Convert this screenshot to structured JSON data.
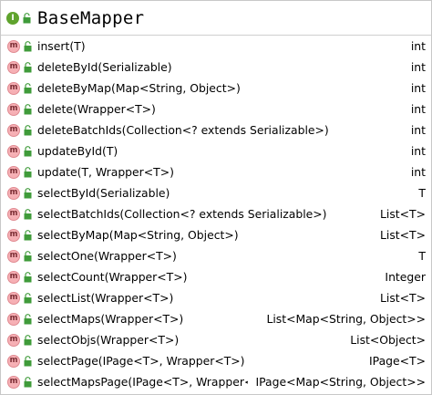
{
  "header": {
    "kind_glyph": "I",
    "title": "BaseMapper",
    "kind_icon": "interface-icon",
    "visibility_icon": "public-lock-icon"
  },
  "methods": [
    {
      "badge": "m",
      "signature": "insert(T)",
      "returns": "int"
    },
    {
      "badge": "m",
      "signature": "deleteById(Serializable)",
      "returns": "int"
    },
    {
      "badge": "m",
      "signature": "deleteByMap(Map<String, Object>)",
      "returns": "int"
    },
    {
      "badge": "m",
      "signature": "delete(Wrapper<T>)",
      "returns": "int"
    },
    {
      "badge": "m",
      "signature": "deleteBatchIds(Collection<? extends Serializable>)",
      "returns": "int"
    },
    {
      "badge": "m",
      "signature": "updateById(T)",
      "returns": "int"
    },
    {
      "badge": "m",
      "signature": "update(T, Wrapper<T>)",
      "returns": "int"
    },
    {
      "badge": "m",
      "signature": "selectById(Serializable)",
      "returns": "T"
    },
    {
      "badge": "m",
      "signature": "selectBatchIds(Collection<? extends Serializable>)",
      "returns": "List<T>"
    },
    {
      "badge": "m",
      "signature": "selectByMap(Map<String, Object>)",
      "returns": "List<T>"
    },
    {
      "badge": "m",
      "signature": "selectOne(Wrapper<T>)",
      "returns": "T"
    },
    {
      "badge": "m",
      "signature": "selectCount(Wrapper<T>)",
      "returns": "Integer"
    },
    {
      "badge": "m",
      "signature": "selectList(Wrapper<T>)",
      "returns": "List<T>"
    },
    {
      "badge": "m",
      "signature": "selectMaps(Wrapper<T>)",
      "returns": "List<Map<String, Object>>"
    },
    {
      "badge": "m",
      "signature": "selectObjs(Wrapper<T>)",
      "returns": "List<Object>"
    },
    {
      "badge": "m",
      "signature": "selectPage(IPage<T>, Wrapper<T>)",
      "returns": "IPage<T>"
    },
    {
      "badge": "m",
      "signature": "selectMapsPage(IPage<T>, Wrapper<T>)",
      "returns": "IPage<Map<String, Object>>"
    }
  ],
  "colors": {
    "interface_badge": "#5fa32d",
    "method_badge": "#f6b0b5",
    "lock_green": "#3f9b3a",
    "border": "#c8c8c8"
  }
}
